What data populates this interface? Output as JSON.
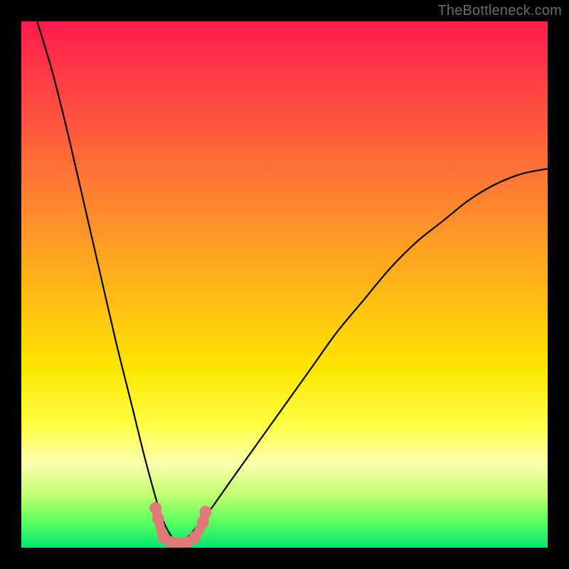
{
  "attribution": "TheBottleneck.com",
  "colors": {
    "page_bg": "#000000",
    "dot": "#e07a7a",
    "curve": "#000000",
    "gradient_stops": [
      "#ff1a4d",
      "#ff3547",
      "#ff5e3c",
      "#ff8a2e",
      "#ffb519",
      "#ffe600",
      "#ffff47",
      "#fbffae",
      "#c0ff70",
      "#5eff5e",
      "#00e56e"
    ]
  },
  "chart_data": {
    "type": "line",
    "title": "",
    "xlabel": "",
    "ylabel": "",
    "xlim": [
      0,
      100
    ],
    "ylim": [
      0,
      100
    ],
    "grid": false,
    "note": "Two smooth branches: sharp descending branch on the left, gentler ascending branch on the right, meeting in a narrow trough near x≈30 at y≈0. Dots mark the trough region.",
    "series": [
      {
        "name": "left-branch",
        "x": [
          3,
          6,
          9,
          12,
          15,
          18,
          21,
          24,
          27,
          30
        ],
        "y": [
          100,
          90,
          78,
          65,
          52,
          39,
          27,
          15,
          5,
          0
        ]
      },
      {
        "name": "right-branch",
        "x": [
          30,
          35,
          40,
          45,
          50,
          55,
          60,
          65,
          70,
          75,
          80,
          85,
          90,
          95,
          100
        ],
        "y": [
          0,
          6,
          13,
          20,
          27,
          34,
          41,
          47,
          53,
          58,
          62,
          66,
          69,
          71,
          72
        ]
      }
    ],
    "dots": [
      {
        "x": 25.5,
        "y": 7.5
      },
      {
        "x": 26.0,
        "y": 5.5
      },
      {
        "x": 27.0,
        "y": 2.0
      },
      {
        "x": 28.5,
        "y": 1.0
      },
      {
        "x": 30.0,
        "y": 0.8
      },
      {
        "x": 31.5,
        "y": 1.0
      },
      {
        "x": 33.0,
        "y": 2.0
      },
      {
        "x": 34.5,
        "y": 4.8
      },
      {
        "x": 35.0,
        "y": 6.8
      }
    ]
  }
}
